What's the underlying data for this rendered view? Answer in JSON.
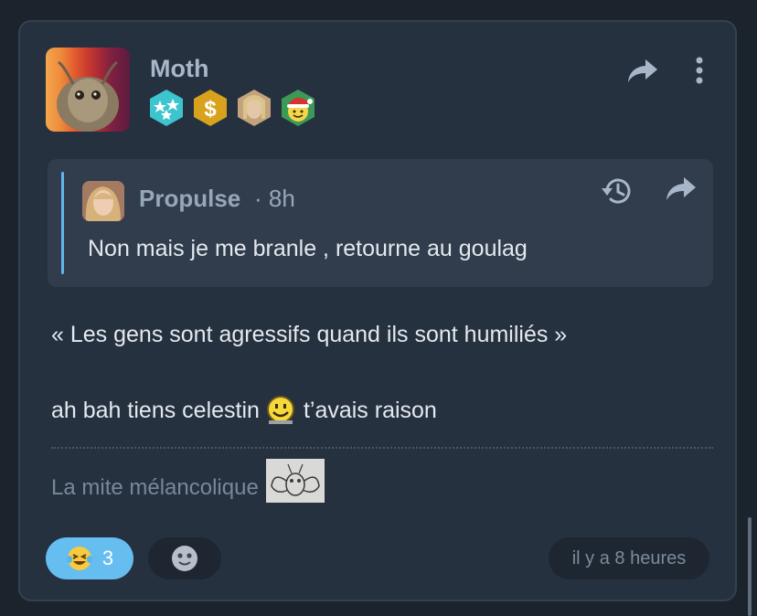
{
  "post": {
    "author": "Moth",
    "badges": [
      "stars-badge-icon",
      "dollar-badge-icon",
      "avatar-badge-icon",
      "santa-emoji-badge-icon"
    ],
    "actions": [
      "share-icon",
      "more-icon"
    ]
  },
  "quote": {
    "author": "Propulse",
    "time": "· 8h",
    "text": "Non mais je me branle , retourne au goulag",
    "accent": "#5fb7ec"
  },
  "body": {
    "line1": "« Les gens sont agressifs quand ils sont humiliés »",
    "line2_before": "ah bah tiens celestin",
    "line2_after": "t’avais raison"
  },
  "signature": {
    "text": "La mite mélancolique"
  },
  "reactions": {
    "active_count": "3",
    "active_emoji": "laughing-crying-emoji-icon",
    "add_emoji": "add-reaction-icon",
    "active_color": "#66bdf0"
  },
  "timestamp": "il y a 8 heures"
}
